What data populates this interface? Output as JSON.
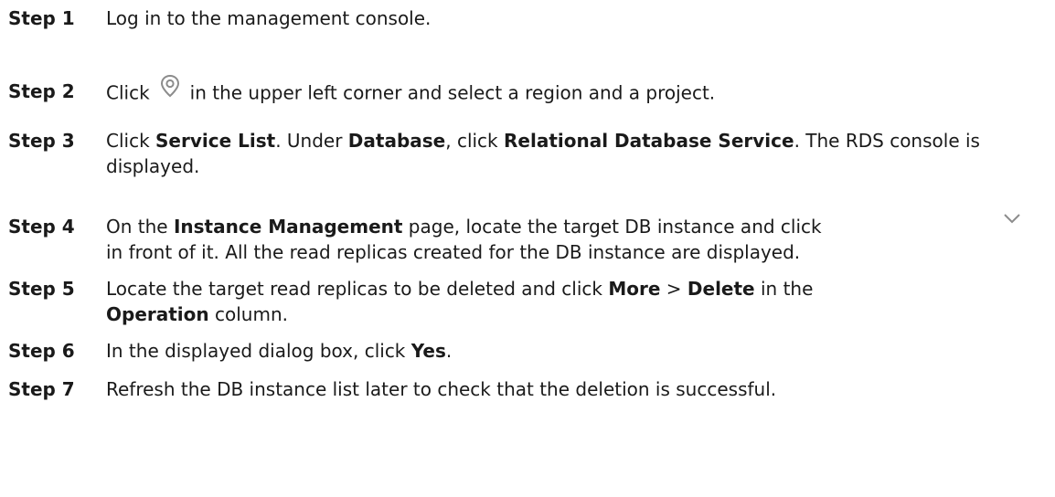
{
  "steps": [
    {
      "label": "Step 1",
      "parts": [
        "Log in to the management console."
      ]
    },
    {
      "label": "Step 2",
      "parts": [
        "Click",
        "in the upper left corner and select a region and a project."
      ],
      "icon": "location-pin-icon"
    },
    {
      "label": "Step 3",
      "parts": [
        "Click ",
        "Service List",
        ". Under ",
        "Database",
        ", click ",
        "Relational Database Service",
        ". The RDS console is displayed."
      ]
    },
    {
      "label": "Step 4",
      "parts": [
        "On the ",
        "Instance Management",
        " page, locate the target DB instance and click",
        "in front of it. All the read replicas created for the DB instance are displayed."
      ],
      "icon": "chevron-down-icon"
    },
    {
      "label": "Step 5",
      "parts": [
        "Locate the target read replicas to be deleted and click ",
        "More",
        " > ",
        "Delete",
        " in the",
        "Operation",
        " column."
      ]
    },
    {
      "label": "Step 6",
      "parts": [
        "In the displayed dialog box, click ",
        "Yes",
        "."
      ]
    },
    {
      "label": "Step 7",
      "parts": [
        "Refresh the DB instance list later to check that the deletion is successful."
      ]
    }
  ],
  "colors": {
    "text": "#1a1a1a",
    "icon": "#8c8c8c"
  }
}
